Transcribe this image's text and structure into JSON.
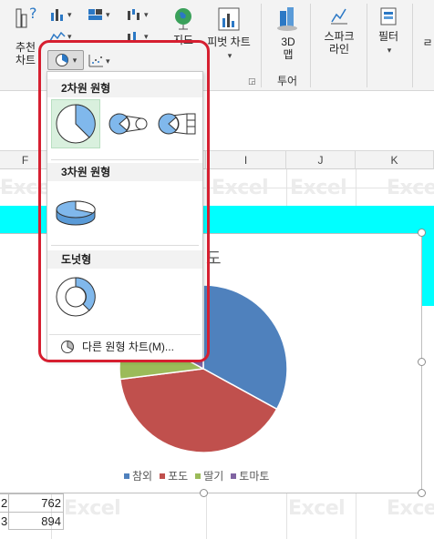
{
  "ribbon": {
    "recommended_chart": "추천\n차트",
    "help_glyph": "?",
    "map": "지도",
    "pivot_chart": "피벗 차트",
    "map_3d": "3D\n맵",
    "sparkline": "스파크\n라인",
    "filter": "필터",
    "tour_group": "투어"
  },
  "sheet": {
    "columns": [
      "F",
      "I",
      "J",
      "K"
    ],
    "watermark": "Excel",
    "rows": [
      {
        "num": "2",
        "value": "762"
      },
      {
        "num": "3",
        "value": "894"
      }
    ]
  },
  "chart": {
    "title_partial": "도",
    "legend": [
      {
        "label": "참외",
        "color": "#4f81bd"
      },
      {
        "label": "포도",
        "color": "#c0504d"
      },
      {
        "label": "딸기",
        "color": "#9bbb59"
      },
      {
        "label": "토마토",
        "color": "#8064a2"
      }
    ]
  },
  "chart_data": {
    "type": "pie",
    "categories": [
      "참외",
      "포도",
      "딸기",
      "토마토"
    ],
    "values": [
      33,
      40,
      10,
      17
    ],
    "colors": [
      "#4f81bd",
      "#c0504d",
      "#9bbb59",
      "#8064a2"
    ],
    "title": "",
    "legend_position": "bottom"
  },
  "dropdown": {
    "section_2d": "2차원 원형",
    "section_3d": "3차원 원형",
    "section_donut": "도넛형",
    "more_charts": "다른 원형 차트(M)...",
    "items_2d": [
      "pie-2d",
      "pie-of-pie",
      "bar-of-pie"
    ],
    "items_3d": [
      "pie-3d"
    ],
    "items_donut": [
      "donut"
    ]
  }
}
